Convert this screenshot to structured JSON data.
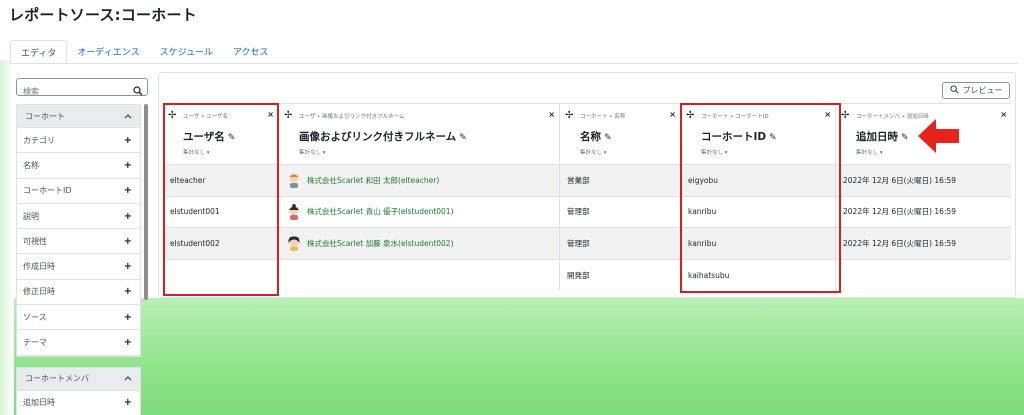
{
  "page": {
    "title": "レポートソース:コーホート"
  },
  "tabs": [
    {
      "label": "エディタ",
      "active": true
    },
    {
      "label": "オーディエンス",
      "active": false
    },
    {
      "label": "スケジュール",
      "active": false
    },
    {
      "label": "アクセス",
      "active": false
    }
  ],
  "search": {
    "placeholder": "検索"
  },
  "sidebar": {
    "groups": [
      {
        "title": "コーホート",
        "items": [
          "カテゴリ",
          "名称",
          "コーホートID",
          "説明",
          "可視性",
          "作成日時",
          "修正日時",
          "ソース",
          "テーマ"
        ]
      },
      {
        "title": "コーホートメンバ",
        "items": [
          "追加日時"
        ]
      }
    ]
  },
  "toolbar": {
    "preview_label": "プレビュー"
  },
  "columns": [
    {
      "category": "ユーザ • ユーザ名",
      "name": "ユーザ名",
      "aggregation": "集計なし"
    },
    {
      "category": "ユーザ • 画像およびリンク付きフルネーム",
      "name": "画像およびリンク付きフルネーム",
      "aggregation": "集計なし"
    },
    {
      "category": "コーホート • 名称",
      "name": "名称",
      "aggregation": "集計なし"
    },
    {
      "category": "コーホート • コーホートID",
      "name": "コーホートID",
      "aggregation": "集計なし"
    },
    {
      "category": "コーホートメンバ • 追加日時",
      "name": "追加日時",
      "aggregation": "集計なし"
    }
  ],
  "rows": [
    {
      "username": "elteacher",
      "fullname": "株式会社Scarlet 和田 太郎(elteacher)",
      "cohort_name": "営業部",
      "cohort_id": "eigyobu",
      "added": "2022年 12月 6日(火曜日) 16:59"
    },
    {
      "username": "elstudent001",
      "fullname": "株式会社Scarlet 青山 優子(elstudent001)",
      "cohort_name": "管理部",
      "cohort_id": "kanribu",
      "added": "2022年 12月 6日(火曜日) 16:59"
    },
    {
      "username": "elstudent002",
      "fullname": "株式会社Scarlet 加藤 泉水(elstudent002)",
      "cohort_name": "管理部",
      "cohort_id": "kanribu",
      "added": "2022年 12月 6日(火曜日) 16:59"
    },
    {
      "username": "",
      "fullname": "",
      "cohort_name": "開発部",
      "cohort_id": "kaihatsubu",
      "added": ""
    }
  ],
  "icons": {
    "search": "search-icon",
    "preview": "magnifier-icon",
    "move": "move-icon",
    "remove": "close-icon",
    "edit": "pencil-icon",
    "collapse": "chevron-up-icon",
    "add": "plus-icon",
    "highlight": "red-arrow-icon"
  },
  "colors": {
    "link": "#1b7a2f",
    "highlight": "#d6201f",
    "background": "#8fe38a"
  }
}
